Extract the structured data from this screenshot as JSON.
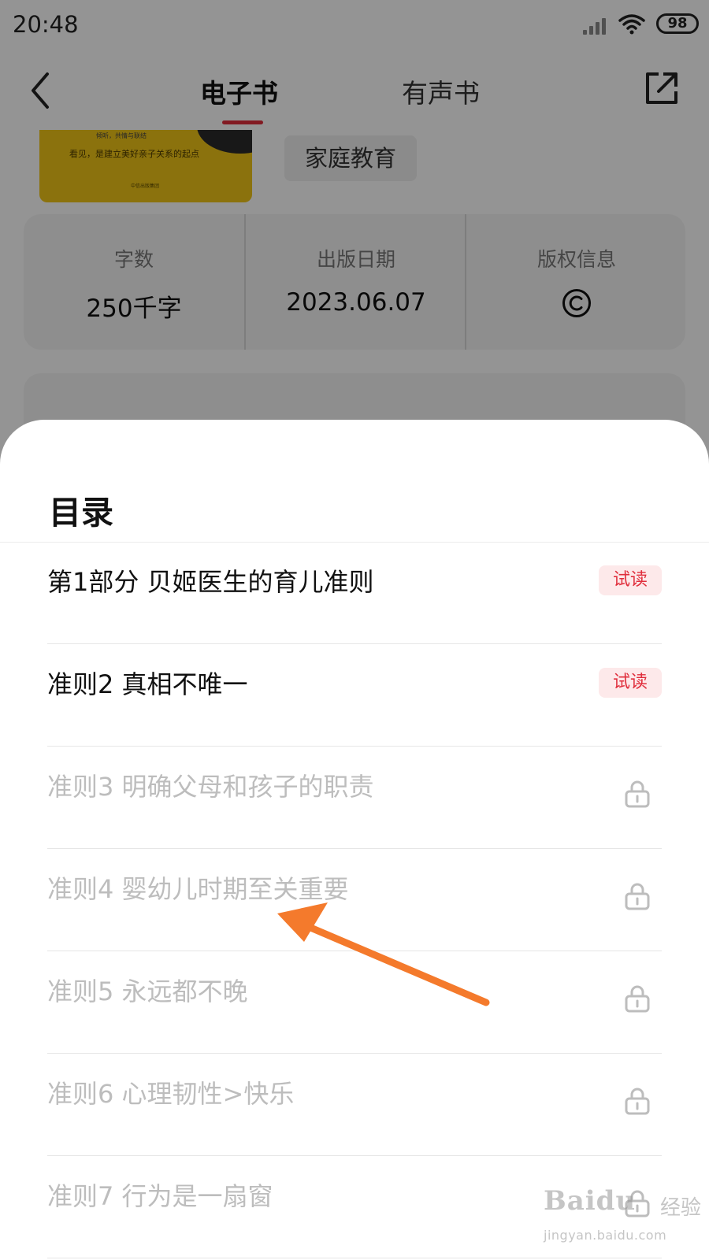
{
  "status_bar": {
    "time": "20:48",
    "battery": "98"
  },
  "nav": {
    "tabs": [
      {
        "label": "电子书",
        "active": true
      },
      {
        "label": "有声书",
        "active": false
      }
    ]
  },
  "book": {
    "cover_top_text": "倾听，共情与联结",
    "cover_slogan": "看见，是建立美好亲子关系的起点",
    "cover_publisher": "中信出版集团",
    "category": "家庭教育"
  },
  "info": [
    {
      "label": "字数",
      "value": "250千字"
    },
    {
      "label": "出版日期",
      "value": "2023.06.07"
    },
    {
      "label": "版权信息",
      "icon": "copyright-icon"
    }
  ],
  "sheet": {
    "title": "目录",
    "items": [
      {
        "title": "第1部分 贝姬医生的育儿准则",
        "badge": "试读",
        "locked": false
      },
      {
        "title": "准则2 真相不唯一",
        "badge": "试读",
        "locked": false
      },
      {
        "title": "准则3 明确父母和孩子的职责",
        "locked": true,
        "icon": "lock-icon"
      },
      {
        "title": "准则4 婴幼儿时期至关重要",
        "locked": true,
        "icon": "lock-icon"
      },
      {
        "title": "准则5 永远都不晚",
        "locked": true,
        "icon": "lock-icon"
      },
      {
        "title": "准则6 心理韧性>快乐",
        "locked": true,
        "icon": "lock-icon"
      },
      {
        "title": "准则7 行为是一扇窗",
        "locked": true,
        "icon": "lock-icon"
      }
    ]
  },
  "watermark": {
    "logo": "Baidu",
    "sub": "经验",
    "url": "jingyan.baidu.com"
  },
  "colors": {
    "accent": "#e02e3c",
    "badge_bg": "#fde9ea",
    "annotation_arrow": "#f47a2c",
    "locked_text": "#bdbdbd"
  }
}
